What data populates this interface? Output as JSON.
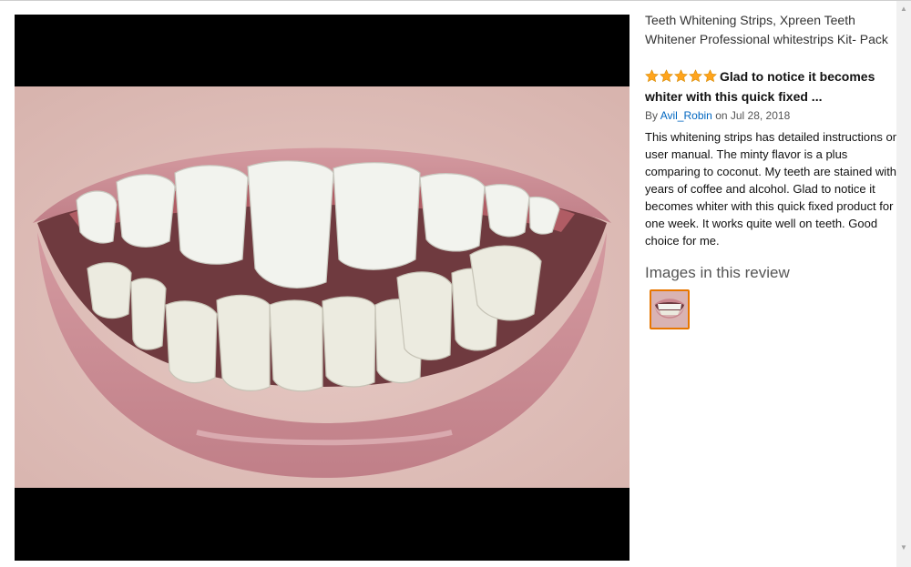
{
  "product": {
    "title_line1": "Teeth Whitening Strips, Xpreen Teeth",
    "title_line2": "Whitener Professional whitestrips Kit- Pack"
  },
  "review": {
    "rating": 5,
    "rating_max": 5,
    "star_color": "#ffa41c",
    "title": "Glad to notice it becomes whiter with this quick fixed ...",
    "by_prefix": "By",
    "author": "Avil_Robin",
    "date_text": "on Jul 28, 2018",
    "body": "This whitening strips has detailed instructions on user manual. The minty flavor is a plus comparing to coconut. My teeth are stained with years of coffee and alcohol. Glad to notice it becomes whiter with this quick fixed product for one week. It works quite well on teeth. Good choice for me."
  },
  "images_section": {
    "heading": "Images in this review"
  },
  "icons": {
    "star": "star-icon",
    "scroll_up": "scroll-up-arrow-icon",
    "scroll_down": "scroll-down-arrow-icon"
  },
  "colors": {
    "link": "#0066c0",
    "thumb_border": "#e77600"
  }
}
